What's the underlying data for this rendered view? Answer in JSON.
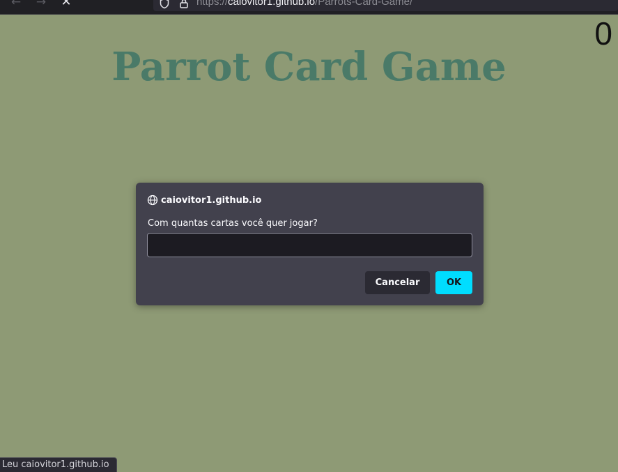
{
  "browser": {
    "url_scheme": "https://",
    "url_host": "caiovitor1.github.io",
    "url_path": "/Parrots-Card-Game/",
    "back_icon": "←",
    "forward_icon": "→",
    "stop_icon": "✕"
  },
  "page": {
    "title": "Parrot Card Game",
    "counter": "0"
  },
  "dialog": {
    "origin": "caiovitor1.github.io",
    "message": "Com quantas cartas você quer jogar?",
    "input_value": "",
    "cancel_label": "Cancelar",
    "ok_label": "OK"
  },
  "status_bar": {
    "text": "Leu caiovitor1.github.io"
  },
  "colors": {
    "page_background": "#8e9a75",
    "title": "#4a7a68",
    "dialog_background": "#42414d",
    "ok_button": "#00ddff"
  }
}
